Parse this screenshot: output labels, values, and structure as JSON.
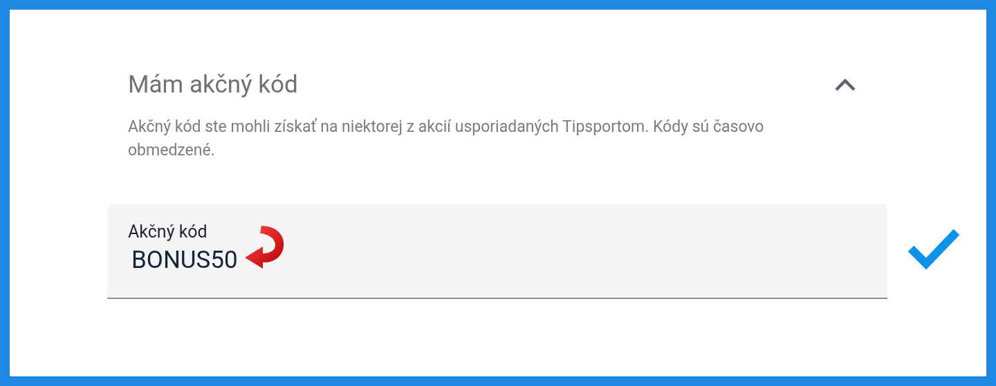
{
  "section": {
    "title": "Mám akčný kód",
    "expanded": true,
    "description": "Akčný kód ste mohli získať na niektorej z akcií usporiadaných Tipsportom. Kódy sú časovo obmedzené."
  },
  "code_field": {
    "label": "Akčný kód",
    "value": "BONUS50",
    "valid": true
  }
}
